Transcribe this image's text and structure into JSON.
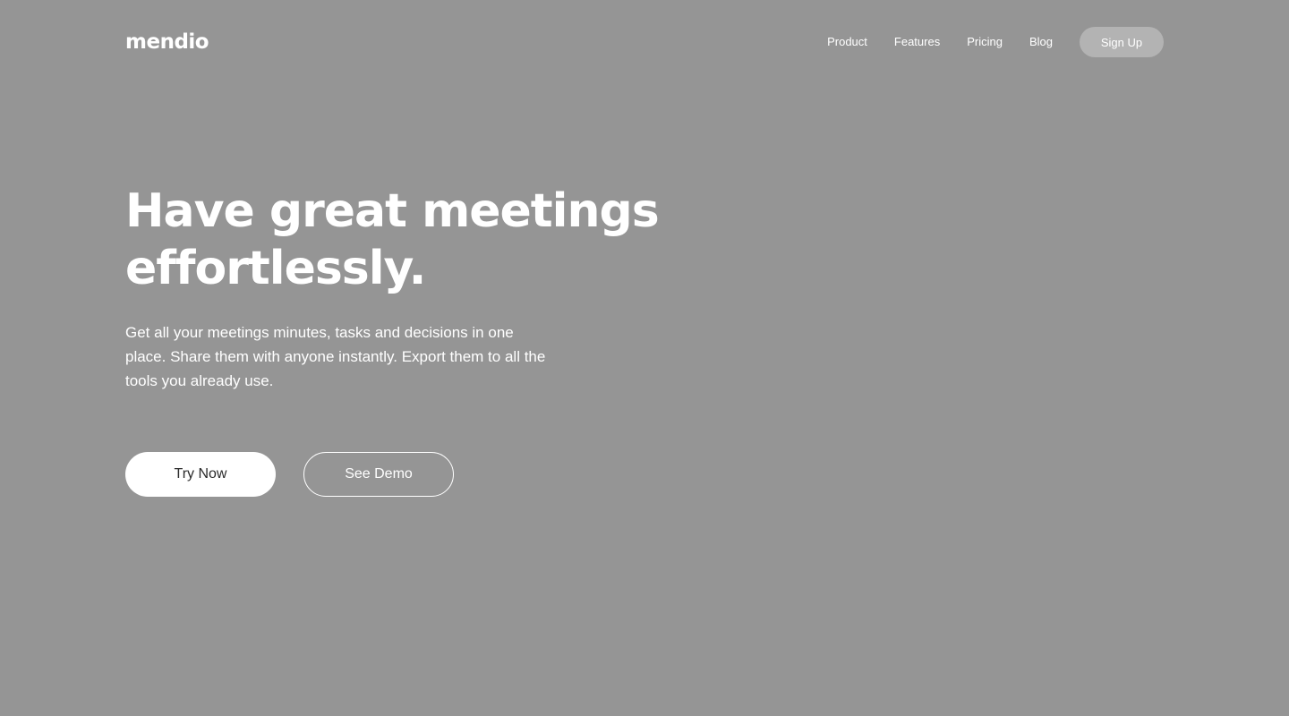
{
  "brand": {
    "logo_text": "mendio"
  },
  "nav": {
    "links": [
      "Product",
      "Features",
      "Pricing",
      "Blog"
    ],
    "signup_label": "Sign Up"
  },
  "hero": {
    "title": "Have great meetings effortlessly.",
    "subtitle": "Get all your meetings minutes, tasks and decisions in one place. Share them with anyone instantly. Export them to all the tools you already use.",
    "primary_cta": "Try Now",
    "secondary_cta": "See Demo"
  },
  "colors": {
    "background": "#959595",
    "signup_button": "#b3b3b3",
    "text": "#ffffff",
    "primary_button_bg": "#ffffff",
    "primary_button_text": "#2a2a2a"
  }
}
